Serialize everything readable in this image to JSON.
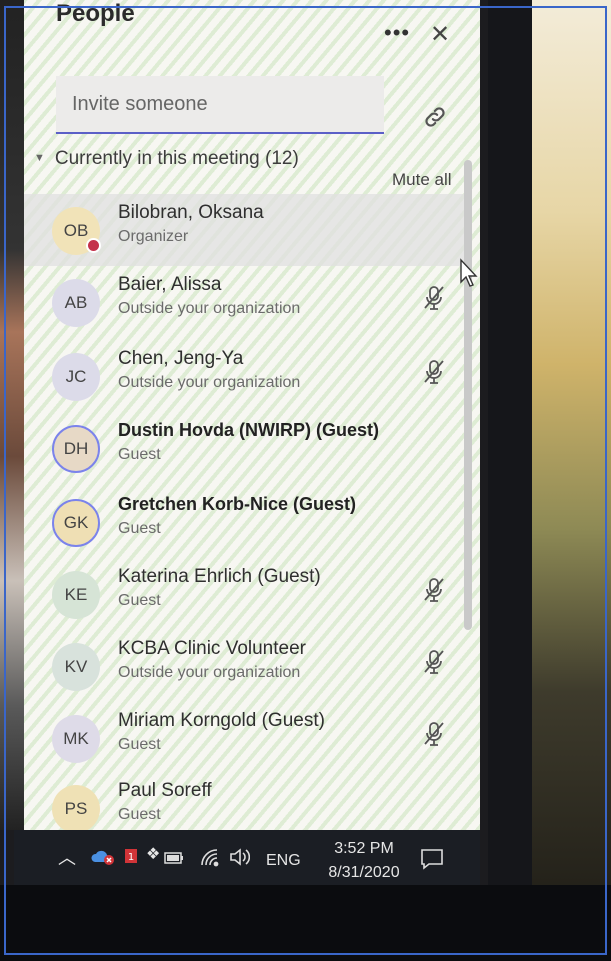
{
  "panel": {
    "title": "People",
    "invite_placeholder": "Invite someone",
    "section_title": "Currently in this meeting (12)",
    "mute_all": "Mute all"
  },
  "participants": [
    {
      "initials": "OB",
      "name": "Bilobran, Oksana",
      "sub": "Organizer",
      "avatar_color": "#f1e3b8",
      "bold": false,
      "ring": false,
      "muted": false,
      "status": "busy"
    },
    {
      "initials": "AB",
      "name": "Baier, Alissa",
      "sub": "Outside your organization",
      "avatar_color": "#dcdbe9",
      "bold": false,
      "ring": false,
      "muted": true
    },
    {
      "initials": "JC",
      "name": "Chen, Jeng-Ya",
      "sub": "Outside your organization",
      "avatar_color": "#dcdbe9",
      "bold": false,
      "ring": false,
      "muted": true
    },
    {
      "initials": "DH",
      "name": "Dustin Hovda (NWIRP) (Guest)",
      "sub": "Guest",
      "avatar_color": "#e7d9c6",
      "bold": true,
      "ring": true,
      "muted": false
    },
    {
      "initials": "GK",
      "name": "Gretchen Korb-Nice (Guest)",
      "sub": "Guest",
      "avatar_color": "#efdfb4",
      "bold": true,
      "ring": true,
      "muted": false
    },
    {
      "initials": "KE",
      "name": "Katerina Ehrlich (Guest)",
      "sub": "Guest",
      "avatar_color": "#d6e4d6",
      "bold": false,
      "ring": false,
      "muted": true
    },
    {
      "initials": "KV",
      "name": "KCBA Clinic Volunteer",
      "sub": "Outside your organization",
      "avatar_color": "#d8e2dc",
      "bold": false,
      "ring": false,
      "muted": true
    },
    {
      "initials": "MK",
      "name": "Miriam Korngold (Guest)",
      "sub": "Guest",
      "avatar_color": "#dedbe8",
      "bold": false,
      "ring": false,
      "muted": true
    },
    {
      "initials": "PS",
      "name": "Paul Soreff",
      "sub": "Guest",
      "avatar_color": "#efe1b5",
      "bold": false,
      "ring": false,
      "muted": false
    }
  ],
  "taskbar": {
    "language": "ENG",
    "time": "3:52 PM",
    "date": "8/31/2020"
  },
  "colors": {
    "accent": "#5b5fc7",
    "busy": "#c4314b",
    "taskbar": "#1b1e24"
  }
}
